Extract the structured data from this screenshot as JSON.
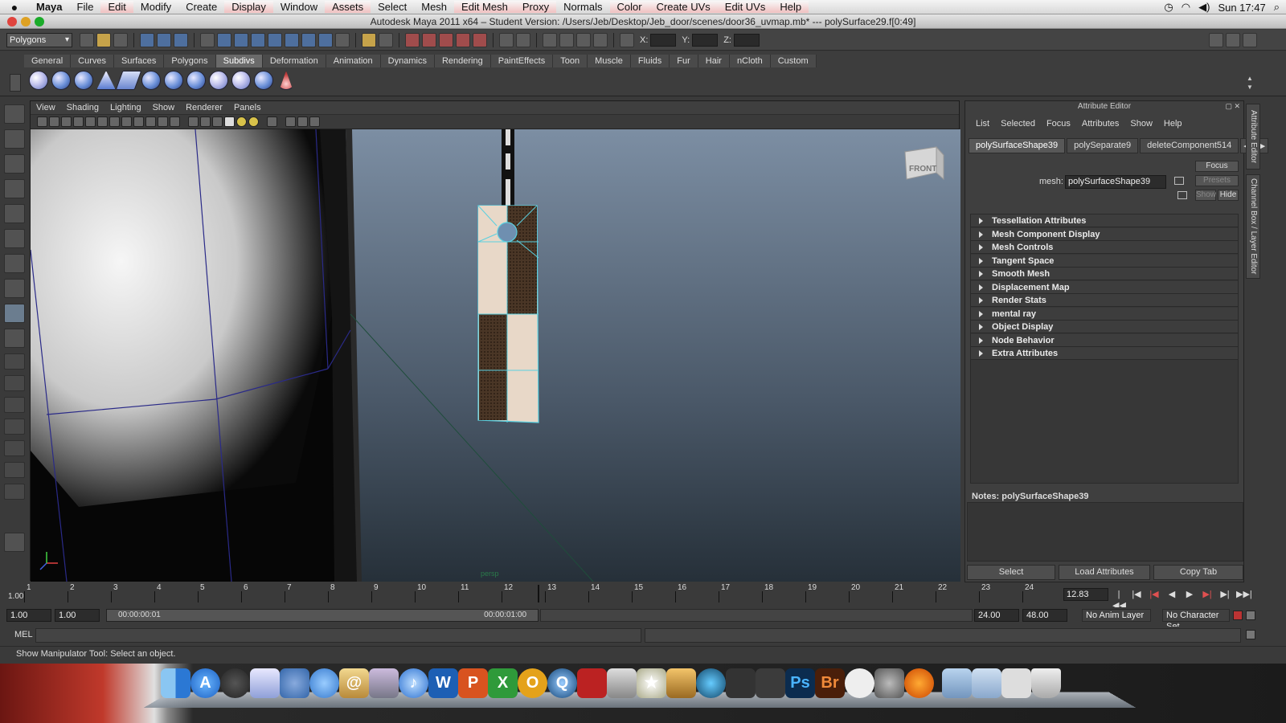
{
  "menubar": {
    "app": "Maya",
    "items": [
      "File",
      "Edit",
      "Modify",
      "Create",
      "Display",
      "Window",
      "Assets",
      "Select",
      "Mesh",
      "Edit Mesh",
      "Proxy",
      "Normals",
      "Color",
      "Create UVs",
      "Edit UVs",
      "Help"
    ],
    "clock": "Sun 17:47"
  },
  "window": {
    "title": "Autodesk Maya 2011 x64 – Student Version: /Users/Jeb/Desktop/Jeb_door/scenes/door36_uvmap.mb*   ---   polySurface29.f[0:49]"
  },
  "statusline": {
    "mode": "Polygons",
    "x_label": "X:",
    "y_label": "Y:",
    "z_label": "Z:"
  },
  "shelf": {
    "tabs": [
      "General",
      "Curves",
      "Surfaces",
      "Polygons",
      "Subdivs",
      "Deformation",
      "Animation",
      "Dynamics",
      "Rendering",
      "PaintEffects",
      "Toon",
      "Muscle",
      "Fluids",
      "Fur",
      "Hair",
      "nCloth",
      "Custom"
    ],
    "active": "Subdivs"
  },
  "viewport": {
    "menu": [
      "View",
      "Shading",
      "Lighting",
      "Show",
      "Renderer",
      "Panels"
    ],
    "viewcube_label": "FRONT",
    "camera": "persp"
  },
  "attribute_editor": {
    "title": "Attribute Editor",
    "menu": [
      "List",
      "Selected",
      "Focus",
      "Attributes",
      "Show",
      "Help"
    ],
    "tabs": [
      "polySurfaceShape39",
      "polySeparate9",
      "deleteComponent514"
    ],
    "mesh_label": "mesh:",
    "mesh_value": "polySurfaceShape39",
    "focus_btn": "Focus",
    "presets_btn": "Presets",
    "show_btn": "Show",
    "hide_btn": "Hide",
    "frames": [
      "Tessellation Attributes",
      "Mesh Component Display",
      "Mesh Controls",
      "Tangent Space",
      "Smooth Mesh",
      "Displacement Map",
      "Render Stats",
      "mental ray",
      "Object Display",
      "Node Behavior",
      "Extra Attributes"
    ],
    "notes_label": "Notes:",
    "notes_value": "polySurfaceShape39",
    "buttons": [
      "Select",
      "Load Attributes",
      "Copy Tab"
    ]
  },
  "side_tabs": [
    "Attribute Editor",
    "Channel Box / Layer Editor"
  ],
  "timeline": {
    "start_label": "1.00",
    "frames": [
      "1",
      "2",
      "3",
      "4",
      "5",
      "6",
      "7",
      "8",
      "9",
      "10",
      "11",
      "12",
      "13",
      "14",
      "15",
      "16",
      "17",
      "18",
      "19",
      "20",
      "21",
      "22",
      "23",
      "24"
    ],
    "current_frame": "12.83"
  },
  "range": {
    "start_time": "1.00",
    "playback_start": "1.00",
    "slider_left": "00:00:00:01",
    "slider_right": "00:00:01:00",
    "playback_end": "24.00",
    "end_time": "48.00",
    "anim_layer": "No Anim Layer",
    "char_set": "No Character Set"
  },
  "command": {
    "mel_label": "MEL",
    "help_text": "Show Manipulator Tool: Select an object."
  },
  "dock": {
    "icons": [
      "finder-icon",
      "app-store-icon",
      "dashboard-icon",
      "preview-icon",
      "ichat-icon",
      "ichat-video-icon",
      "address-book-icon",
      "iphoto-icon",
      "itunes-icon",
      "word-icon",
      "powerpoint-icon",
      "excel-icon",
      "outlook-icon",
      "quicktime-icon",
      "photo-booth-icon",
      "image-capture-icon",
      "imovie-icon",
      "garageband-icon",
      "time-machine-icon",
      "maya-icon",
      "maya2-icon",
      "photoshop-icon",
      "bridge-icon",
      "mouse-icon",
      "system-prefs-icon",
      "firefox-icon",
      "folder-icon",
      "folder2-icon",
      "calendar-icon",
      "trash-icon"
    ]
  }
}
